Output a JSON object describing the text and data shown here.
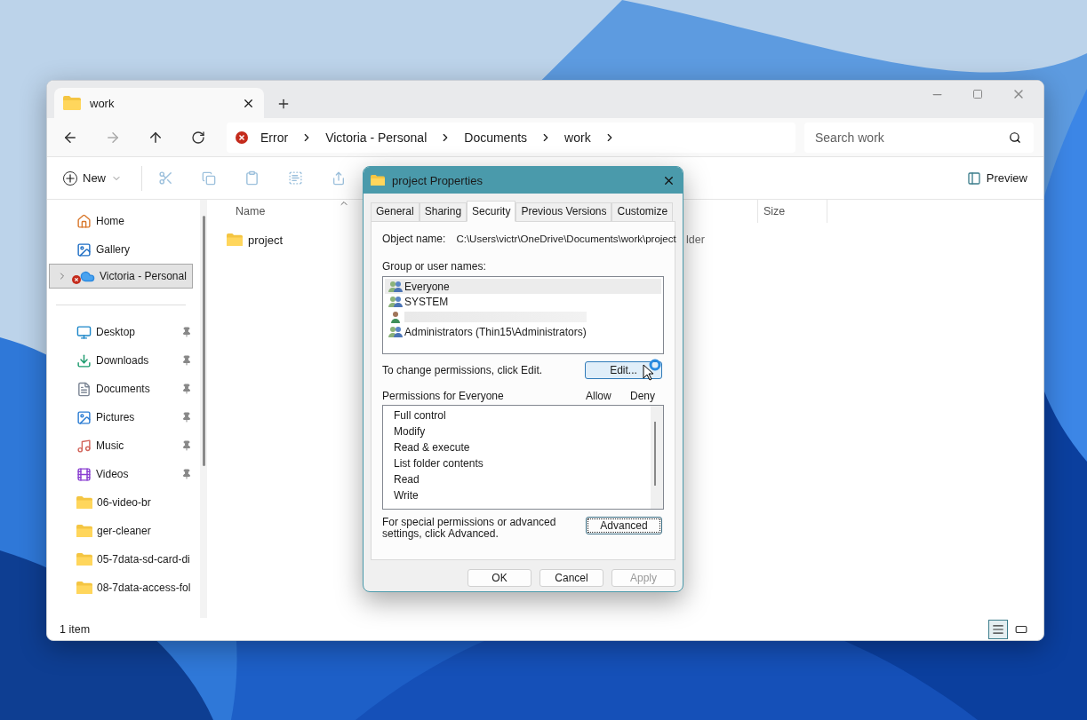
{
  "explorer": {
    "tab": {
      "title": "work",
      "selected": true
    },
    "breadcrumb": [
      {
        "label": "Error",
        "kind": "error"
      },
      {
        "label": "Victoria - Personal",
        "kind": "crumb"
      },
      {
        "label": "Documents",
        "kind": "crumb"
      },
      {
        "label": "work",
        "kind": "crumb"
      }
    ],
    "search": {
      "placeholder": "Search work"
    },
    "commands": {
      "new": "New",
      "preview": "Preview"
    },
    "sidebar": {
      "top_items": [
        {
          "label": "Home",
          "kind": "home",
          "selected": false,
          "error": false,
          "expandable": false
        },
        {
          "label": "Gallery",
          "kind": "gallery",
          "selected": false,
          "error": false,
          "expandable": false
        },
        {
          "label": "Victoria - Personal",
          "kind": "cloud",
          "selected": true,
          "error": true,
          "expandable": true
        }
      ],
      "quick_access": [
        {
          "label": "Desktop",
          "kind": "desktop",
          "pinned": true
        },
        {
          "label": "Downloads",
          "kind": "downloads",
          "pinned": true
        },
        {
          "label": "Documents",
          "kind": "documents",
          "pinned": true
        },
        {
          "label": "Pictures",
          "kind": "pictures",
          "pinned": true
        },
        {
          "label": "Music",
          "kind": "music",
          "pinned": true
        },
        {
          "label": "Videos",
          "kind": "videos",
          "pinned": true
        },
        {
          "label": "06-video-br",
          "kind": "folder",
          "pinned": false
        },
        {
          "label": "ger-cleaner",
          "kind": "folder",
          "pinned": false
        },
        {
          "label": "05-7data-sd-card-di",
          "kind": "folder",
          "pinned": false
        },
        {
          "label": "08-7data-access-fol",
          "kind": "folder",
          "pinned": false
        }
      ]
    },
    "columns": [
      {
        "label": "Name",
        "sorted": true
      },
      {
        "label": "Size",
        "sorted": false
      }
    ],
    "files": [
      {
        "name": "project",
        "type": "lder"
      }
    ],
    "status_bar": "1 item",
    "view_modes": [
      {
        "kind": "details",
        "selected": true
      },
      {
        "kind": "tiles",
        "selected": false
      }
    ]
  },
  "dialog": {
    "title": "project Properties",
    "tabs": [
      {
        "label": "General",
        "selected": false
      },
      {
        "label": "Sharing",
        "selected": false
      },
      {
        "label": "Security",
        "selected": true
      },
      {
        "label": "Previous Versions",
        "selected": false
      },
      {
        "label": "Customize",
        "selected": false
      }
    ],
    "object_name_label": "Object name:",
    "object_name": "C:\\Users\\victr\\OneDrive\\Documents\\work\\project",
    "groups_label": "Group or user names:",
    "groups": [
      {
        "name": "Everyone",
        "kind": "group",
        "selected": true,
        "redacted": false
      },
      {
        "name": "SYSTEM",
        "kind": "group",
        "selected": false,
        "redacted": false
      },
      {
        "kind": "user",
        "selected": false,
        "redacted": true
      },
      {
        "name": "Administrators (Thin15\\Administrators)",
        "kind": "group",
        "selected": false,
        "redacted": false
      }
    ],
    "change_hint": "To change permissions, click Edit.",
    "edit_button": "Edit...",
    "permissions_label": "Permissions for Everyone",
    "permission_columns": [
      "Allow",
      "Deny"
    ],
    "permissions": [
      "Full control",
      "Modify",
      "Read & execute",
      "List folder contents",
      "Read",
      "Write"
    ],
    "advanced_hint": "For special permissions or advanced settings, click Advanced.",
    "advanced_button": "Advanced",
    "buttons": [
      {
        "label": "OK",
        "disabled": false
      },
      {
        "label": "Cancel",
        "disabled": false
      },
      {
        "label": "Apply",
        "disabled": true
      }
    ]
  }
}
